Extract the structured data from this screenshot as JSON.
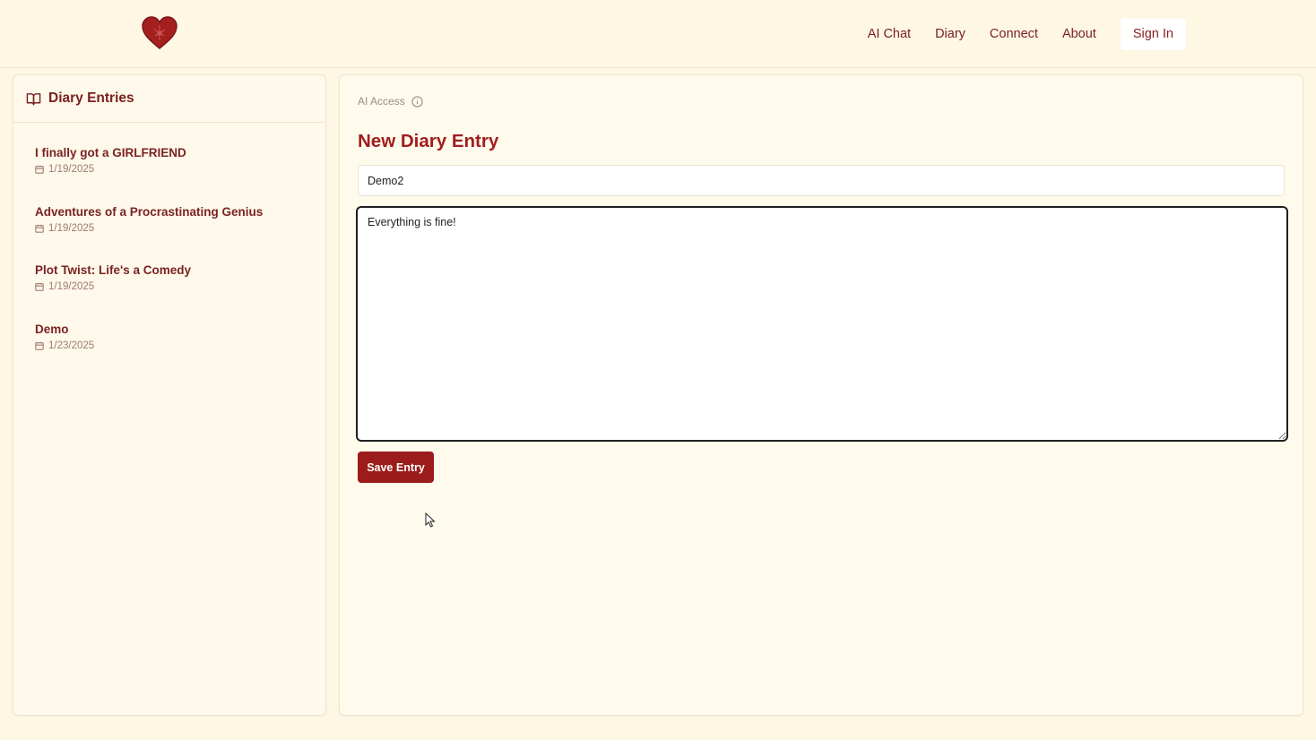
{
  "nav": {
    "logo_icon": "heart-icon",
    "items": [
      "AI Chat",
      "Diary",
      "Connect",
      "About"
    ],
    "sign_in": "Sign In"
  },
  "sidebar": {
    "title": "Diary Entries",
    "title_icon": "book-open-icon",
    "entries": [
      {
        "title": "I finally got a GIRLFRIEND",
        "date": "1/19/2025"
      },
      {
        "title": "Adventures of a Procrastinating Genius",
        "date": "1/19/2025"
      },
      {
        "title": "Plot Twist: Life's a Comedy",
        "date": "1/19/2025"
      },
      {
        "title": "Demo",
        "date": "1/23/2025"
      }
    ]
  },
  "editor": {
    "ai_access_label": "AI Access",
    "heading": "New Diary Entry",
    "title_value": "Demo2",
    "body_value": "Everything is fine!",
    "save_label": "Save Entry"
  },
  "colors": {
    "background": "#fdf7e4",
    "accent": "#9c1b1b",
    "text": "#7a1f1f"
  }
}
